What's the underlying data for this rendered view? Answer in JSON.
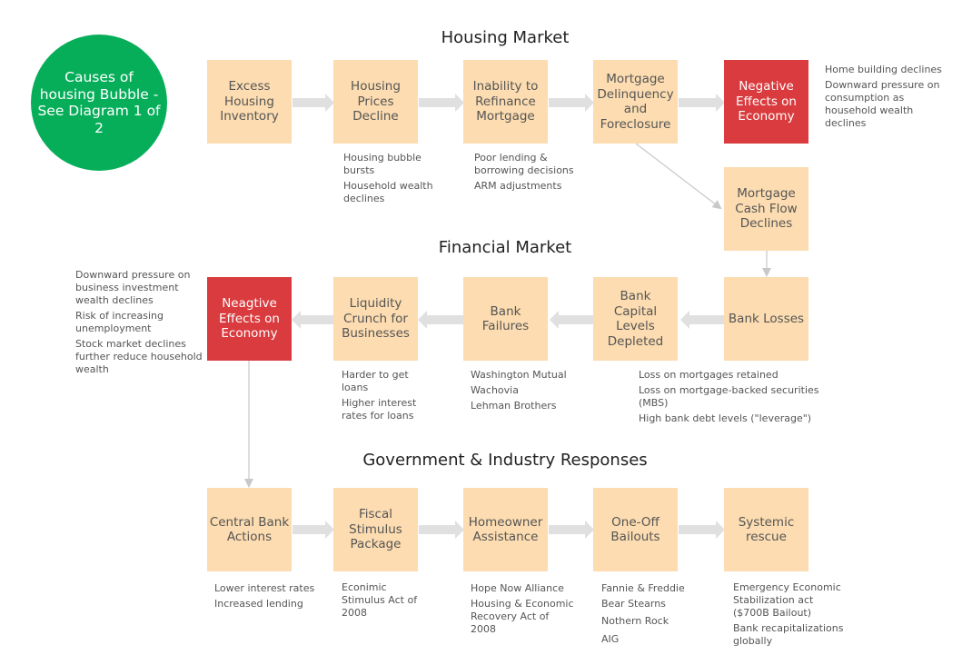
{
  "colors": {
    "box_fill": "#fcdcb0",
    "negative_fill": "#d93b3e",
    "circle_fill": "#07ae5a",
    "arrow": "#e0e0e0",
    "connector": "#c8c8c8"
  },
  "start_circle": {
    "label": "Causes of housing Bubble - See Diagram 1 of 2"
  },
  "sections": {
    "housing": {
      "title": "Housing Market"
    },
    "financial": {
      "title": "Financial Market"
    },
    "government": {
      "title": "Government & Industry Responses"
    }
  },
  "housing_boxes": [
    {
      "label": "Excess Housing Inventory",
      "notes": []
    },
    {
      "label": "Housing Prices Decline",
      "notes": [
        "Housing bubble bursts",
        "Household wealth declines"
      ]
    },
    {
      "label": "Inability to Refinance Mortgage",
      "notes": [
        "Poor lending & borrowing decisions",
        "ARM adjustments"
      ]
    },
    {
      "label": "Mortgage Delinquency and Foreclosure",
      "notes": []
    },
    {
      "label": "Negative Effects on Economy",
      "notes": [
        "Home building declines",
        "Downward pressure on consumption as household wealth declines"
      ]
    }
  ],
  "cash_flow_box": {
    "label": "Mortgage Cash Flow Declines"
  },
  "financial_boxes": [
    {
      "label": "Bank Losses",
      "notes": [
        "Loss on mortgages retained",
        "Loss on mortgage-backed securities (MBS)",
        "High bank debt levels (\"leverage\")"
      ]
    },
    {
      "label": "Bank Capital Levels Depleted",
      "notes": []
    },
    {
      "label": "Bank Failures",
      "notes": [
        "Washington Mutual",
        "Wachovia",
        "Lehman Brothers"
      ]
    },
    {
      "label": "Liquidity Crunch for Businesses",
      "notes": [
        "Harder to get loans",
        "Higher interest rates for loans"
      ]
    },
    {
      "label": "Neagtive Effects on Economy",
      "notes": [
        "Downward pressure on business investment wealth declines",
        "Risk of increasing unemployment",
        "Stock market declines further reduce household wealth"
      ]
    }
  ],
  "government_boxes": [
    {
      "label": "Central Bank Actions",
      "notes": [
        "Lower interest rates",
        "Increased lending"
      ]
    },
    {
      "label": "Fiscal Stimulus Package",
      "notes": [
        "Econimic Stimulus Act of  2008"
      ]
    },
    {
      "label": "Homeowner Assistance",
      "notes": [
        "Hope Now Alliance",
        "Housing & Economic Recovery Act of 2008"
      ]
    },
    {
      "label": "One-Off Bailouts",
      "notes": [
        "Fannie & Freddie",
        "Bear Stearns",
        "Nothern Rock",
        "AIG"
      ]
    },
    {
      "label": "Systemic rescue",
      "notes": [
        "Emergency Economic Stabilization act ($700B Bailout)",
        "Bank recapitalizations globally"
      ]
    }
  ]
}
